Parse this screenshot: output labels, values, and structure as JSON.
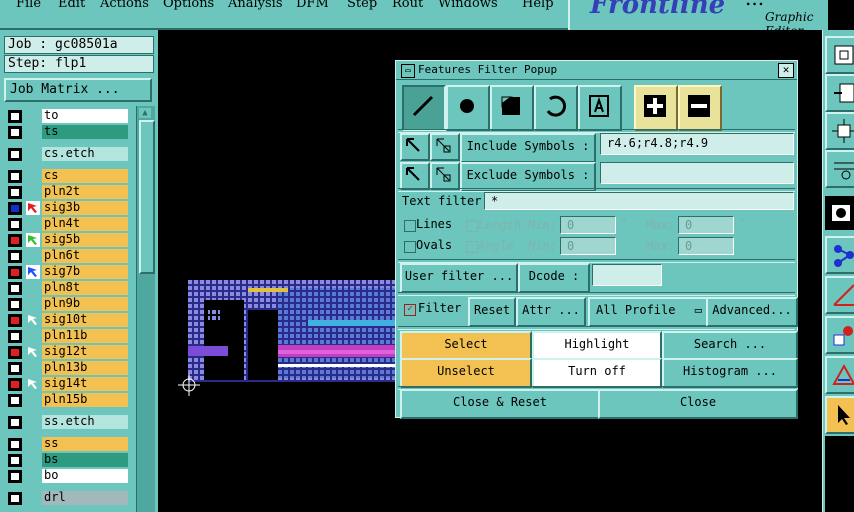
{
  "menu": {
    "items": [
      "File",
      "Edit",
      "Actions",
      "Options",
      "Analysis",
      "DFM",
      "Step",
      "Rout",
      "Windows",
      "Help"
    ]
  },
  "brand": {
    "logo": "Frontline",
    "logo_partial": "...",
    "subtitle": "Graphic Editor"
  },
  "job": {
    "job_label": "Job : gc08501a",
    "step_label": "Step: flp1",
    "matrix_button": "Job Matrix ..."
  },
  "layers": [
    {
      "name": "to",
      "color": "white",
      "check": "empty",
      "arrow": ""
    },
    {
      "name": "ts",
      "color": "green",
      "check": "empty",
      "arrow": ""
    },
    {
      "name": "cs.etch",
      "color": "lightteal",
      "check": "empty",
      "arrow": ""
    },
    {
      "name": "cs",
      "color": "yellow",
      "check": "empty",
      "arrow": ""
    },
    {
      "name": "pln2t",
      "color": "yellow",
      "check": "empty",
      "arrow": ""
    },
    {
      "name": "sig3b",
      "color": "yellow",
      "check": "blue",
      "arrow": "red"
    },
    {
      "name": "pln4t",
      "color": "yellow",
      "check": "empty",
      "arrow": ""
    },
    {
      "name": "sig5b",
      "color": "yellow",
      "check": "red",
      "arrow": "green"
    },
    {
      "name": "pln6t",
      "color": "yellow",
      "check": "empty",
      "arrow": ""
    },
    {
      "name": "sig7b",
      "color": "yellow",
      "check": "red",
      "arrow": "blue"
    },
    {
      "name": "pln8t",
      "color": "yellow",
      "check": "empty",
      "arrow": ""
    },
    {
      "name": "pln9b",
      "color": "yellow",
      "check": "empty",
      "arrow": ""
    },
    {
      "name": "sig10t",
      "color": "yellow",
      "check": "red",
      "arrow": "white"
    },
    {
      "name": "pln11b",
      "color": "yellow",
      "check": "empty",
      "arrow": ""
    },
    {
      "name": "sig12t",
      "color": "yellow",
      "check": "red",
      "arrow": "white"
    },
    {
      "name": "pln13b",
      "color": "yellow",
      "check": "empty",
      "arrow": ""
    },
    {
      "name": "sig14t",
      "color": "yellow",
      "check": "red",
      "arrow": "white"
    },
    {
      "name": "pln15b",
      "color": "yellow",
      "check": "empty",
      "arrow": ""
    },
    {
      "name": "ss.etch",
      "color": "lightteal",
      "check": "empty",
      "arrow": ""
    },
    {
      "name": "ss",
      "color": "yellow",
      "check": "empty",
      "arrow": ""
    },
    {
      "name": "bs",
      "color": "green",
      "check": "empty",
      "arrow": ""
    },
    {
      "name": "bo",
      "color": "white",
      "check": "empty",
      "arrow": ""
    },
    {
      "name": "drl",
      "color": "gray",
      "check": "empty",
      "arrow": ""
    }
  ],
  "popup": {
    "title": "Features Filter Popup",
    "close_glyph": "✕",
    "include_symbols_label": "Include Symbols :",
    "include_symbols_value": "r4.6;r4.8;r4.9",
    "exclude_symbols_label": "Exclude Symbols :",
    "exclude_symbols_value": "",
    "text_filter_label": "Text filter",
    "text_filter_value": "*",
    "lines_label": "Lines",
    "ovals_label": "Ovals",
    "length_label": "Length",
    "angle_label": "Angle",
    "min_label": "Min:",
    "max_label": "Max:",
    "length_min": "0",
    "length_max": "0",
    "angle_min": "0",
    "angle_max": "0",
    "quote_mark": "\"",
    "user_filter_button": "User filter ...",
    "dcode_label": "Dcode :",
    "dcode_value": "",
    "filter_label": "Filter",
    "reset_button": "Reset",
    "attr_button": "Attr ...",
    "all_profile_button": "All Profile",
    "advanced_button": "Advanced...",
    "select_button": "Select",
    "highlight_button": "Highlight",
    "search_button": "Search ...",
    "unselect_button": "Unselect",
    "turn_off_button": "Turn off",
    "histogram_button": "Histogram ...",
    "close_reset_button": "Close & Reset",
    "close_button": "Close"
  },
  "colors": {
    "panel": "#6cc6bd",
    "yellow_layer": "#f3c152",
    "green_layer": "#2e9a80",
    "brand_blue": "#3540b8"
  }
}
